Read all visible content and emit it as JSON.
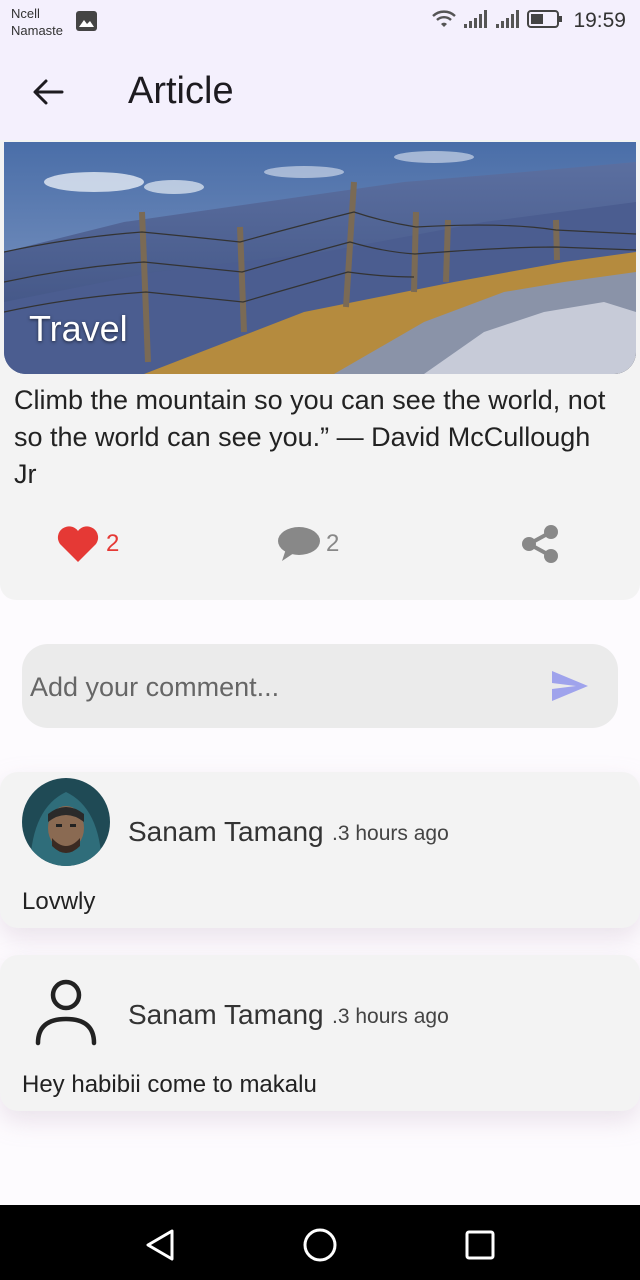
{
  "status_bar": {
    "carrier_line1": "Ncell",
    "carrier_line2": "Namaste",
    "time": "19:59",
    "icons": [
      "gallery-icon",
      "wifi-icon",
      "signal-icon",
      "signal-icon",
      "battery-icon"
    ]
  },
  "app_bar": {
    "title": "Article",
    "back_icon": "arrow-left-icon"
  },
  "article": {
    "category": "Travel",
    "quote": "Climb the mountain so you can see the world, not so the world can see you.” — David McCullough Jr",
    "likes": "2",
    "comments": "2",
    "icons": [
      "heart-icon",
      "comment-bubble-icon",
      "share-icon"
    ],
    "like_color": "#e53935"
  },
  "comment_input": {
    "placeholder": "Add your comment...",
    "value": "",
    "send_icon": "send-icon",
    "send_color": "#9fa3ec"
  },
  "comments": [
    {
      "author": "Sanam Tamang",
      "time_ago": ".3 hours ago",
      "text": "Lovwly",
      "avatar": "photo"
    },
    {
      "author": "Sanam Tamang",
      "time_ago": ".3 hours ago",
      "text": "Hey habibii come to makalu",
      "avatar": "person-outline-icon"
    }
  ],
  "nav_bar": {
    "icons": [
      "back-triangle-icon",
      "home-circle-icon",
      "recents-square-icon"
    ]
  }
}
